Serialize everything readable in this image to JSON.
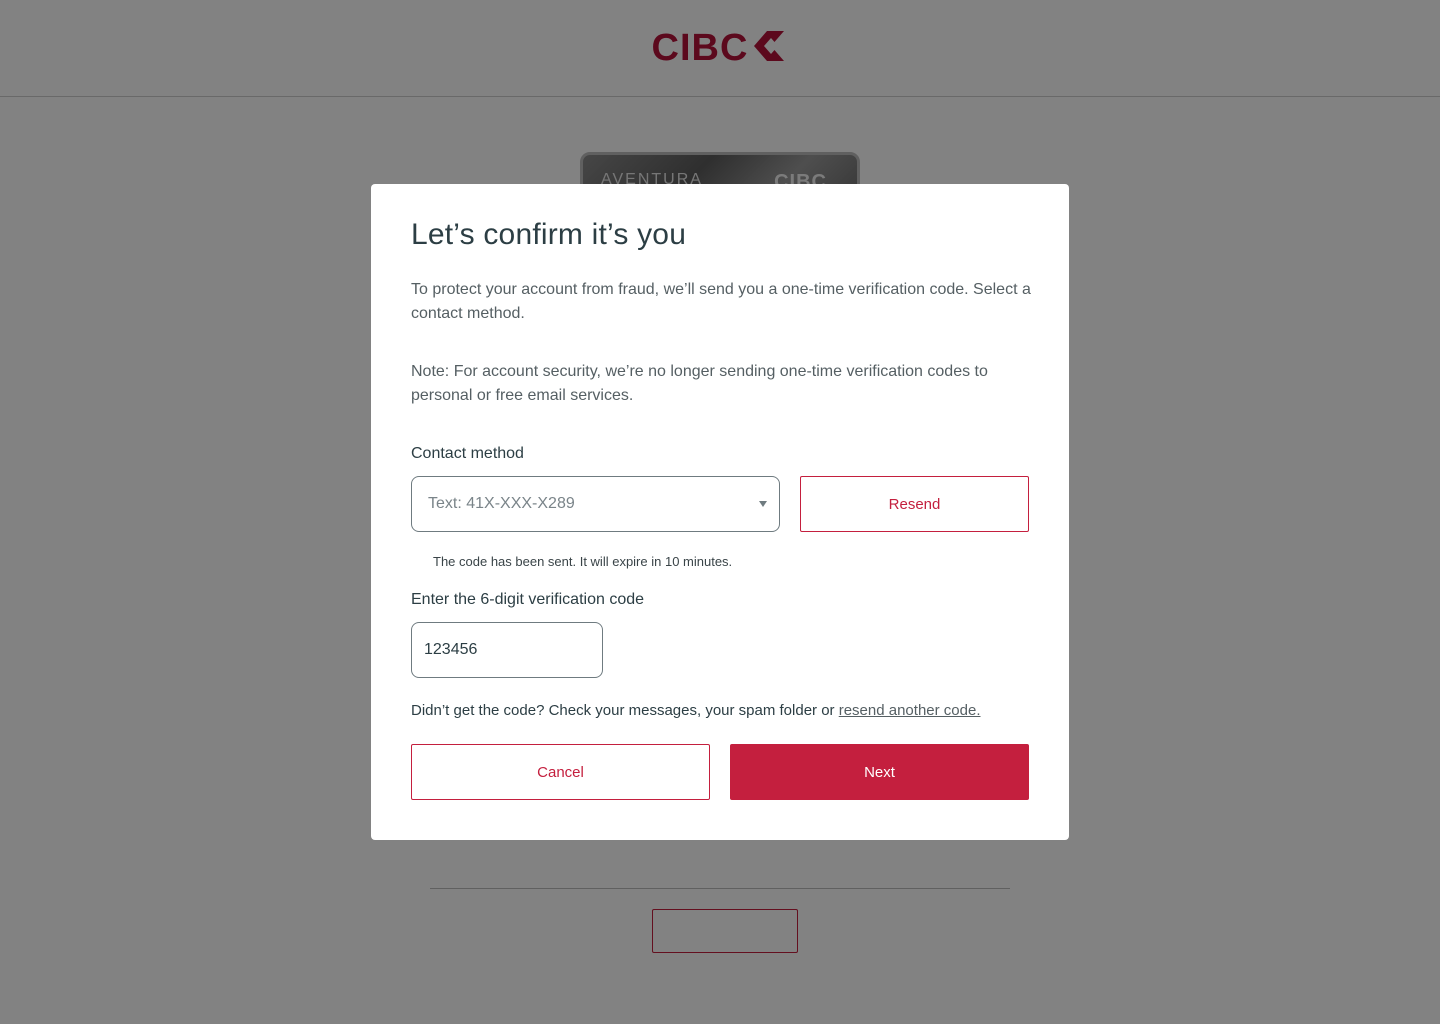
{
  "brand": {
    "logo_text": "CIBC",
    "logo_icon": "cibc-diamond-icon",
    "color": "#b5123a"
  },
  "background": {
    "card_brand": "AVENTURA",
    "card_logo": "CIBC"
  },
  "modal": {
    "title": "Let’s confirm it’s you",
    "intro": "To protect your account from fraud, we’ll send you a one-time verification code. Select a contact method.",
    "note": "Note: For account security, we’re no longer sending one-time verification codes to personal or free email services.",
    "contact_label": "Contact method",
    "contact_selected": "Text: 41X-XXX-X289",
    "resend_label": "Resend",
    "status": "The code has been sent. It will expire in 10 minutes.",
    "code_label": "Enter the 6-digit verification code",
    "code_value": "123456",
    "help_text": "Didn’t get the code? Check your messages, your spam folder or ",
    "help_link": "resend another code.",
    "cancel_label": "Cancel",
    "next_label": "Next"
  },
  "colors": {
    "accent": "#c41f3e",
    "text": "#2c3e44",
    "overlay": "rgba(0,0,0,0.49)"
  }
}
